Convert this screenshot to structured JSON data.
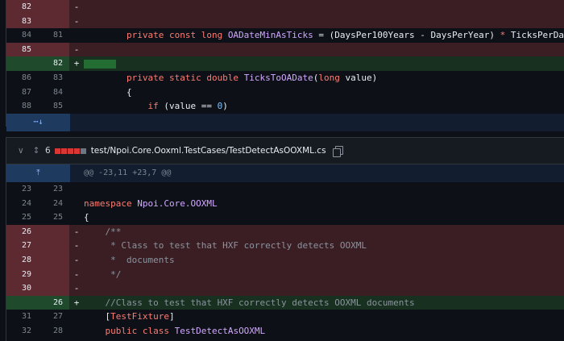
{
  "file1": {
    "rows": [
      {
        "type": "del",
        "old": "82",
        "new": "",
        "mark": "-",
        "tokens": []
      },
      {
        "type": "del",
        "old": "83",
        "new": "",
        "mark": "-",
        "tokens": []
      },
      {
        "type": "ctx",
        "old": "84",
        "new": "81",
        "mark": "",
        "tokens": [
          {
            "c": "kw",
            "t": "        private const long "
          },
          {
            "c": "id",
            "t": "OADateMinAsTicks"
          },
          {
            "c": "plain",
            "t": " = (DaysPer100Years - DaysPerYear) "
          },
          {
            "c": "kw",
            "t": "*"
          },
          {
            "c": "plain",
            "t": " TicksPerDay;"
          }
        ]
      },
      {
        "type": "del",
        "old": "85",
        "new": "",
        "mark": "-",
        "tokens": []
      },
      {
        "type": "add",
        "old": "",
        "new": "82",
        "mark": "+",
        "block": true,
        "tokens": []
      },
      {
        "type": "ctx",
        "old": "86",
        "new": "83",
        "mark": "",
        "tokens": [
          {
            "c": "kw",
            "t": "        private static double "
          },
          {
            "c": "id",
            "t": "TicksToOADate"
          },
          {
            "c": "plain",
            "t": "("
          },
          {
            "c": "kw",
            "t": "long"
          },
          {
            "c": "plain",
            "t": " value)"
          }
        ]
      },
      {
        "type": "ctx",
        "old": "87",
        "new": "84",
        "mark": "",
        "tokens": [
          {
            "c": "plain",
            "t": "        {"
          }
        ]
      },
      {
        "type": "ctx",
        "old": "88",
        "new": "85",
        "mark": "",
        "tokens": [
          {
            "c": "kw",
            "t": "            if"
          },
          {
            "c": "plain",
            "t": " (value == "
          },
          {
            "c": "num",
            "t": "0"
          },
          {
            "c": "plain",
            "t": ")"
          }
        ]
      }
    ],
    "expand_glyph": "⋯↓"
  },
  "file2": {
    "changes_count": "6",
    "path": "test/Npoi.Core.Ooxml.TestCases/TestDetectAsOOXML.cs",
    "hunk_header": "@@ -23,11 +23,7 @@",
    "expand_up_glyph": "⤒",
    "rows": [
      {
        "type": "ctx",
        "old": "23",
        "new": "23",
        "mark": "",
        "tokens": []
      },
      {
        "type": "ctx",
        "old": "24",
        "new": "24",
        "mark": "",
        "tokens": [
          {
            "c": "kw",
            "t": "namespace "
          },
          {
            "c": "id",
            "t": "Npoi.Core.OOXML"
          }
        ]
      },
      {
        "type": "ctx",
        "old": "25",
        "new": "25",
        "mark": "",
        "tokens": [
          {
            "c": "plain",
            "t": "{"
          }
        ]
      },
      {
        "type": "del",
        "old": "26",
        "new": "",
        "mark": "-",
        "tokens": [
          {
            "c": "cm",
            "t": "    /**"
          }
        ]
      },
      {
        "type": "del",
        "old": "27",
        "new": "",
        "mark": "-",
        "tokens": [
          {
            "c": "cm",
            "t": "     * Class to test that HXF correctly detects OOXML"
          }
        ]
      },
      {
        "type": "del",
        "old": "28",
        "new": "",
        "mark": "-",
        "tokens": [
          {
            "c": "cm",
            "t": "     *  documents"
          }
        ]
      },
      {
        "type": "del",
        "old": "29",
        "new": "",
        "mark": "-",
        "tokens": [
          {
            "c": "cm",
            "t": "     */"
          }
        ]
      },
      {
        "type": "del",
        "old": "30",
        "new": "",
        "mark": "-",
        "tokens": []
      },
      {
        "type": "add",
        "old": "",
        "new": "26",
        "mark": "+",
        "tokens": [
          {
            "c": "cm",
            "t": "    //Class to test that HXF correctly detects OOXML documents"
          }
        ]
      },
      {
        "type": "ctx",
        "old": "31",
        "new": "27",
        "mark": "",
        "tokens": [
          {
            "c": "plain",
            "t": "    ["
          },
          {
            "c": "attr",
            "t": "TestFixture"
          },
          {
            "c": "plain",
            "t": "]"
          }
        ]
      },
      {
        "type": "ctx",
        "old": "32",
        "new": "28",
        "mark": "",
        "tokens": [
          {
            "c": "kw",
            "t": "    public class "
          },
          {
            "c": "id",
            "t": "TestDetectAsOOXML"
          }
        ]
      }
    ]
  }
}
